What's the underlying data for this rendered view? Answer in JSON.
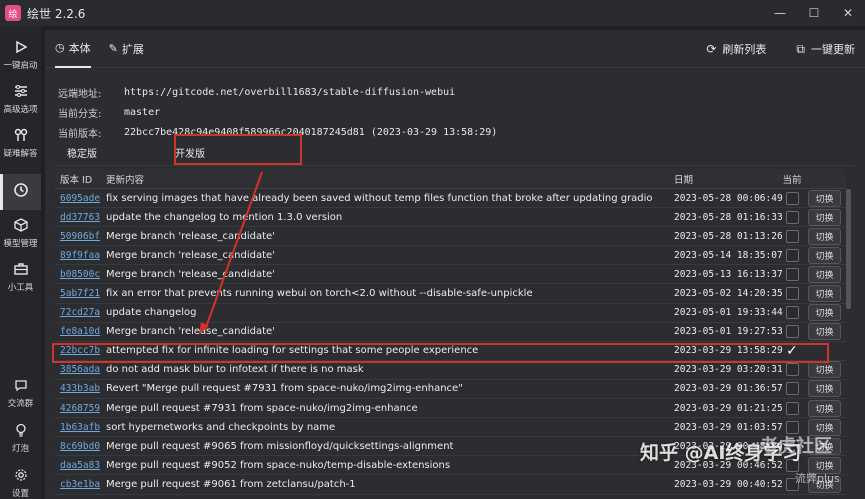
{
  "app": {
    "title": "绘世 2.2.6",
    "logo_glyph": "绘",
    "logo_color": "#e64c8a"
  },
  "window": {
    "min": "—",
    "max": "☐",
    "close": "✕"
  },
  "sidebar": {
    "items": [
      {
        "label": "一键启动",
        "icon": "play-icon"
      },
      {
        "label": "高级选项",
        "icon": "list-settings-icon"
      },
      {
        "label": "疑难解答",
        "icon": "tools-icon"
      },
      {
        "label": "",
        "icon": "history-icon"
      },
      {
        "label": "模型管理",
        "icon": "cube-icon"
      },
      {
        "label": "小工具",
        "icon": "toolbox-icon"
      },
      {
        "label": "交流群",
        "icon": "chat-icon"
      },
      {
        "label": "灯泡",
        "icon": "lightbulb-icon"
      },
      {
        "label": "设置",
        "icon": "gear-icon"
      }
    ]
  },
  "tabs": [
    {
      "label": "本体",
      "icon": "clock-icon"
    },
    {
      "label": "扩展",
      "icon": "puzzle-icon"
    }
  ],
  "actions": {
    "refresh": "刷新列表",
    "one_click": "一键更新"
  },
  "info": {
    "remote_label": "远端地址:",
    "remote_value": "https://gitcode.net/overbill1683/stable-diffusion-webui",
    "branch_label": "当前分支:",
    "branch_value": "master",
    "version_label": "当前版本:",
    "version_value": "22bcc7be428c94e9408f589966c2040187245d81 (2023-03-29 13:58:29)"
  },
  "subtabs": {
    "stable": "稳定版",
    "dev": "开发版"
  },
  "table": {
    "headers": {
      "id": "版本 ID",
      "msg": "更新内容",
      "date": "日期",
      "current": "当前"
    },
    "switch_label": "切换",
    "rows": [
      {
        "id": "6095ade",
        "msg": "fix serving images that have already been saved without temp files function that broke after updating gradio",
        "date": "2023-05-28 00:06:49",
        "current": false
      },
      {
        "id": "dd37763",
        "msg": "update the changelog to mention 1.3.0 version",
        "date": "2023-05-28 01:16:33",
        "current": false
      },
      {
        "id": "50906bf",
        "msg": "Merge branch 'release_candidate'",
        "date": "2023-05-28 01:13:26",
        "current": false
      },
      {
        "id": "89f9faa",
        "msg": "Merge branch 'release_candidate'",
        "date": "2023-05-14 18:35:07",
        "current": false
      },
      {
        "id": "b08500c",
        "msg": "Merge branch 'release_candidate'",
        "date": "2023-05-13 16:13:37",
        "current": false
      },
      {
        "id": "5ab7f21",
        "msg": "fix an error that prevents running webui on torch<2.0 without --disable-safe-unpickle",
        "date": "2023-05-02 14:20:35",
        "current": false
      },
      {
        "id": "72cd27a",
        "msg": "update changelog",
        "date": "2023-05-01 19:33:44",
        "current": false
      },
      {
        "id": "fe8a10d",
        "msg": "Merge branch 'release_candidate'",
        "date": "2023-05-01 19:27:53",
        "current": false
      },
      {
        "id": "22bcc7b",
        "msg": "attempted fix for infinite loading for settings that some people experience",
        "date": "2023-03-29 13:58:29",
        "current": true
      },
      {
        "id": "3856ada",
        "msg": "do not add mask blur to infotext if there is no mask",
        "date": "2023-03-29 03:20:31",
        "current": false
      },
      {
        "id": "433b3ab",
        "msg": "Revert \"Merge pull request #7931 from space-nuko/img2img-enhance\"",
        "date": "2023-03-29 01:36:57",
        "current": false
      },
      {
        "id": "4268759",
        "msg": "Merge pull request #7931 from space-nuko/img2img-enhance",
        "date": "2023-03-29 01:21:25",
        "current": false
      },
      {
        "id": "1b63afb",
        "msg": "sort hypernetworks and checkpoints by name",
        "date": "2023-03-29 01:03:57",
        "current": false
      },
      {
        "id": "8c69bd0",
        "msg": "Merge pull request #9065 from missionfloyd/quicksettings-alignment",
        "date": "2023-03-29 00:48:36",
        "current": false
      },
      {
        "id": "daa5a83",
        "msg": "Merge pull request #9052 from space-nuko/temp-disable-extensions",
        "date": "2023-03-29 00:46:52",
        "current": false
      },
      {
        "id": "cb3e1ba",
        "msg": "Merge pull request #9061 from zetclansu/patch-1",
        "date": "2023-03-29 00:40:52",
        "current": false
      }
    ]
  },
  "watermark": {
    "text": "知乎 @AI终身学习",
    "site": "老虎社区",
    "sub": "流弊plus"
  },
  "colors": {
    "highlight": "#d2322a",
    "link": "#6fa8dc"
  }
}
